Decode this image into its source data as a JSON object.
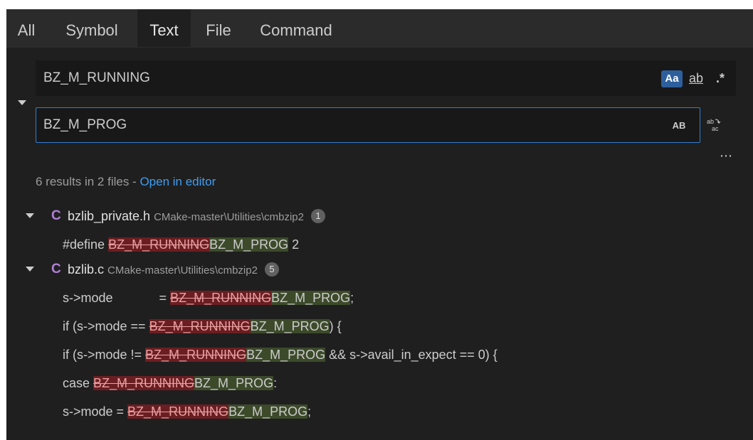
{
  "tabs": [
    "All",
    "Symbol",
    "Text",
    "File",
    "Command"
  ],
  "search": {
    "value": "BZ_M_RUNNING",
    "options": [
      "Aa",
      "ab",
      ".*"
    ]
  },
  "replace": {
    "value": "BZ_M_PROG",
    "options": [
      "AB"
    ],
    "replace_all_icon": "replace-all-icon"
  },
  "more_label": "⋯",
  "summary": {
    "text": "6 results in 2 files - ",
    "link": "Open in editor"
  },
  "files": [
    {
      "icon": "C",
      "name": "bzlib_private.h",
      "path": "CMake-master\\Utilities\\cmbzip2",
      "count": "1",
      "matches": [
        {
          "before": "#define ",
          "removed": "BZ_M_RUNNING",
          "added": "BZ_M_PROG",
          "after": "   2"
        }
      ]
    },
    {
      "icon": "C",
      "name": "bzlib.c",
      "path": "CMake-master\\Utilities\\cmbzip2",
      "count": "5",
      "matches": [
        {
          "before": "s->mode             = ",
          "removed": "BZ_M_RUNNING",
          "added": "BZ_M_PROG",
          "after": ";"
        },
        {
          "before": "if (s->mode == ",
          "removed": "BZ_M_RUNNING",
          "added": "BZ_M_PROG",
          "after": ") {"
        },
        {
          "before": "if (s->mode != ",
          "removed": "BZ_M_RUNNING",
          "added": "BZ_M_PROG",
          "after": " && s->avail_in_expect == 0) {"
        },
        {
          "before": "case ",
          "removed": "BZ_M_RUNNING",
          "added": "BZ_M_PROG",
          "after": ":"
        },
        {
          "before": "s->mode = ",
          "removed": "BZ_M_RUNNING",
          "added": "BZ_M_PROG",
          "after": ";"
        }
      ]
    }
  ]
}
